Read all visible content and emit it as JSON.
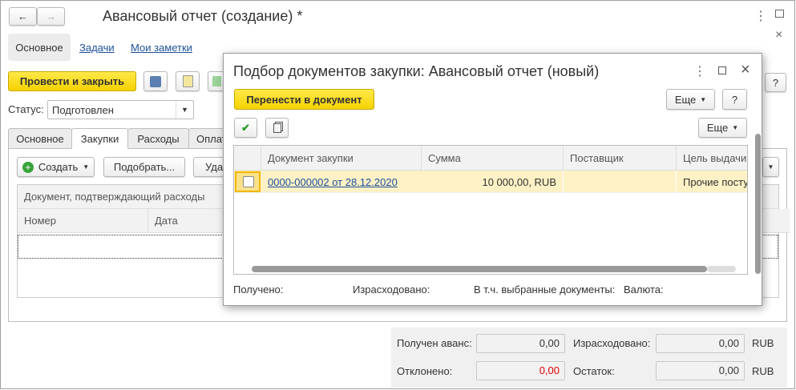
{
  "window": {
    "title": "Авансовый отчет (создание) *"
  },
  "nav": {
    "items": [
      "Основное",
      "Задачи",
      "Мои заметки"
    ]
  },
  "toolbar": {
    "post_close": "Провести и закрыть",
    "help": "?"
  },
  "status": {
    "label": "Статус:",
    "value": "Подготовлен"
  },
  "tabs": [
    "Основное",
    "Закупки",
    "Расходы",
    "Оплат"
  ],
  "purchases": {
    "create": "Создать",
    "select": "Подобрать...",
    "delete": "Удал",
    "table_title": "Документ, подтверждающий расходы",
    "columns": [
      "Номер",
      "Дата"
    ]
  },
  "totals": {
    "received_label": "Получен аванс:",
    "received": "0,00",
    "spent_label": "Израсходовано:",
    "spent": "0,00",
    "currency1": "RUB",
    "rejected_label": "Отклонено:",
    "rejected": "0,00",
    "balance_label": "Остаток:",
    "balance": "0,00",
    "currency2": "RUB"
  },
  "dialog": {
    "title": "Подбор документов закупки: Авансовый отчет (новый)",
    "transfer": "Перенести в документ",
    "more": "Еще",
    "help": "?",
    "more2": "Еще",
    "columns": [
      "Документ закупки",
      "Сумма",
      "Поставщик",
      "Цель выдачи"
    ],
    "rows": [
      {
        "doc": "0000-000002 от 28.12.2020",
        "sum": "10 000,00, RUB",
        "supplier": "",
        "purpose": "Прочие посту"
      }
    ],
    "footer": [
      "Получено:",
      "Израсходовано:",
      "В т.ч. выбранные документы:",
      "Валюта:"
    ]
  },
  "colors": {
    "accent": "#f5d200",
    "row_selected": "#fdf1c5",
    "link": "#1c4f9c",
    "negative": "#e00000"
  }
}
